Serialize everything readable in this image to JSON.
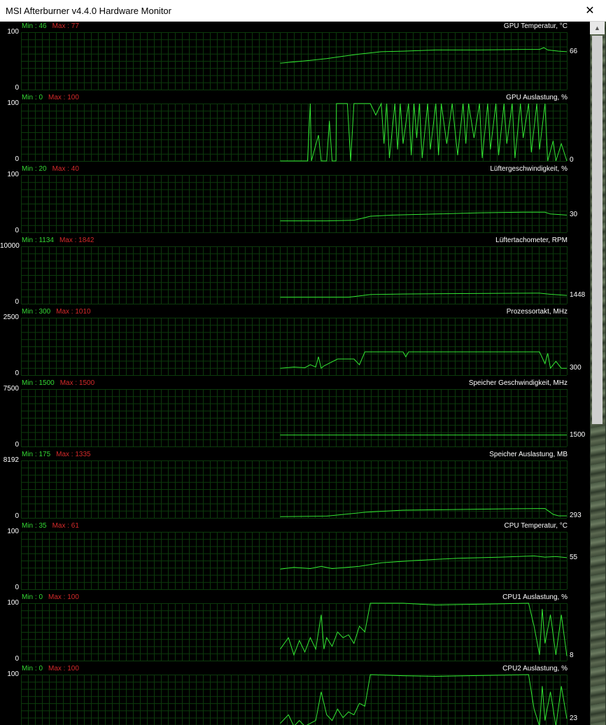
{
  "window": {
    "title": "MSI Afterburner v4.4.0 Hardware Monitor",
    "close_glyph": "✕"
  },
  "graphs": [
    {
      "name": "GPU Temperatur, °C",
      "min_label": "Min : 46",
      "max_label": "Max : 77",
      "axis_max": "100",
      "axis_min": "0",
      "current": "66",
      "max_val": 100,
      "current_val": 66,
      "points": [
        [
          0.475,
          46
        ],
        [
          0.52,
          50
        ],
        [
          0.56,
          54
        ],
        [
          0.59,
          58
        ],
        [
          0.62,
          62
        ],
        [
          0.66,
          66
        ],
        [
          0.7,
          67
        ],
        [
          0.76,
          69
        ],
        [
          0.84,
          69
        ],
        [
          0.92,
          70
        ],
        [
          0.95,
          70
        ],
        [
          0.958,
          73
        ],
        [
          0.965,
          69
        ],
        [
          0.985,
          67
        ],
        [
          1.0,
          66
        ]
      ]
    },
    {
      "name": "GPU Auslastung, %",
      "min_label": "Min : 0",
      "max_label": "Max : 100",
      "axis_max": "100",
      "axis_min": "0",
      "current": "0",
      "max_val": 100,
      "current_val": 0,
      "style": "spiky",
      "points": [
        [
          0.475,
          0
        ],
        [
          0.525,
          0
        ],
        [
          0.53,
          100
        ],
        [
          0.532,
          0
        ],
        [
          0.545,
          45
        ],
        [
          0.55,
          0
        ],
        [
          0.56,
          0
        ],
        [
          0.565,
          70
        ],
        [
          0.57,
          0
        ],
        [
          0.577,
          0
        ],
        [
          0.578,
          100
        ],
        [
          0.59,
          100
        ],
        [
          0.598,
          100
        ],
        [
          0.604,
          0
        ],
        [
          0.61,
          100
        ],
        [
          0.64,
          100
        ],
        [
          0.65,
          80
        ],
        [
          0.66,
          100
        ],
        [
          0.665,
          30
        ],
        [
          0.67,
          100
        ],
        [
          0.675,
          5
        ],
        [
          0.685,
          100
        ],
        [
          0.69,
          20
        ],
        [
          0.695,
          100
        ],
        [
          0.7,
          30
        ],
        [
          0.71,
          100
        ],
        [
          0.715,
          10
        ],
        [
          0.72,
          100
        ],
        [
          0.725,
          40
        ],
        [
          0.73,
          100
        ],
        [
          0.735,
          5
        ],
        [
          0.745,
          100
        ],
        [
          0.75,
          20
        ],
        [
          0.76,
          100
        ],
        [
          0.765,
          10
        ],
        [
          0.77,
          100
        ],
        [
          0.78,
          30
        ],
        [
          0.79,
          100
        ],
        [
          0.8,
          10
        ],
        [
          0.81,
          100
        ],
        [
          0.815,
          30
        ],
        [
          0.82,
          100
        ],
        [
          0.83,
          40
        ],
        [
          0.84,
          100
        ],
        [
          0.845,
          5
        ],
        [
          0.855,
          100
        ],
        [
          0.86,
          20
        ],
        [
          0.87,
          100
        ],
        [
          0.875,
          10
        ],
        [
          0.885,
          100
        ],
        [
          0.89,
          30
        ],
        [
          0.9,
          100
        ],
        [
          0.905,
          5
        ],
        [
          0.915,
          100
        ],
        [
          0.92,
          40
        ],
        [
          0.93,
          100
        ],
        [
          0.935,
          15
        ],
        [
          0.945,
          100
        ],
        [
          0.95,
          20
        ],
        [
          0.96,
          100
        ],
        [
          0.965,
          0
        ],
        [
          0.975,
          35
        ],
        [
          0.98,
          0
        ],
        [
          0.99,
          30
        ],
        [
          1.0,
          0
        ]
      ]
    },
    {
      "name": "Lüftergeschwindigkeit, %",
      "min_label": "Min : 20",
      "max_label": "Max : 40",
      "axis_max": "100",
      "axis_min": "0",
      "current": "30",
      "max_val": 100,
      "current_val": 30,
      "points": [
        [
          0.475,
          20
        ],
        [
          0.56,
          20
        ],
        [
          0.61,
          21
        ],
        [
          0.64,
          28
        ],
        [
          0.68,
          30
        ],
        [
          0.76,
          32
        ],
        [
          0.84,
          34
        ],
        [
          0.92,
          35
        ],
        [
          0.96,
          35
        ],
        [
          0.97,
          32
        ],
        [
          1.0,
          30
        ]
      ]
    },
    {
      "name": "Lüftertachometer, RPM",
      "min_label": "Min : 1134",
      "max_label": "Max : 1842",
      "axis_max": "10000",
      "axis_min": "0",
      "current": "1448",
      "max_val": 10000,
      "current_val": 1448,
      "points": [
        [
          0.475,
          1134
        ],
        [
          0.6,
          1134
        ],
        [
          0.64,
          1600
        ],
        [
          0.7,
          1700
        ],
        [
          0.78,
          1760
        ],
        [
          0.88,
          1820
        ],
        [
          0.95,
          1842
        ],
        [
          0.97,
          1650
        ],
        [
          1.0,
          1448
        ]
      ]
    },
    {
      "name": "Prozessortakt, MHz",
      "min_label": "Min : 300",
      "max_label": "Max : 1010",
      "axis_max": "2500",
      "axis_min": "0",
      "current": "300",
      "max_val": 2500,
      "current_val": 300,
      "points": [
        [
          0.475,
          300
        ],
        [
          0.5,
          350
        ],
        [
          0.52,
          320
        ],
        [
          0.53,
          450
        ],
        [
          0.54,
          350
        ],
        [
          0.545,
          800
        ],
        [
          0.55,
          300
        ],
        [
          0.555,
          400
        ],
        [
          0.58,
          700
        ],
        [
          0.61,
          700
        ],
        [
          0.62,
          450
        ],
        [
          0.63,
          1010
        ],
        [
          0.7,
          1010
        ],
        [
          0.705,
          800
        ],
        [
          0.71,
          1010
        ],
        [
          0.95,
          1010
        ],
        [
          0.96,
          500
        ],
        [
          0.965,
          950
        ],
        [
          0.97,
          300
        ],
        [
          0.98,
          600
        ],
        [
          0.99,
          300
        ],
        [
          1.0,
          300
        ]
      ]
    },
    {
      "name": "Speicher Geschwindigkeit, MHz",
      "min_label": "Min : 1500",
      "max_label": "Max : 1500",
      "axis_max": "7500",
      "axis_min": "0",
      "current": "1500",
      "max_val": 7500,
      "current_val": 1500,
      "points": [
        [
          0.475,
          1500
        ],
        [
          1.0,
          1500
        ]
      ]
    },
    {
      "name": "Speicher Auslastung, MB",
      "min_label": "Min : 175",
      "max_label": "Max : 1335",
      "axis_max": "8192",
      "axis_min": "0",
      "current": "293",
      "max_val": 8192,
      "current_val": 293,
      "points": [
        [
          0.475,
          175
        ],
        [
          0.56,
          250
        ],
        [
          0.63,
          800
        ],
        [
          0.7,
          1100
        ],
        [
          0.8,
          1200
        ],
        [
          0.9,
          1300
        ],
        [
          0.96,
          1335
        ],
        [
          0.975,
          500
        ],
        [
          0.985,
          293
        ],
        [
          1.0,
          293
        ]
      ]
    },
    {
      "name": "CPU Temperatur, °C",
      "min_label": "Min : 35",
      "max_label": "Max : 61",
      "axis_max": "100",
      "axis_min": "0",
      "current": "55",
      "max_val": 100,
      "current_val": 55,
      "points": [
        [
          0.475,
          35
        ],
        [
          0.5,
          38
        ],
        [
          0.53,
          36
        ],
        [
          0.55,
          40
        ],
        [
          0.57,
          36
        ],
        [
          0.62,
          40
        ],
        [
          0.66,
          46
        ],
        [
          0.72,
          50
        ],
        [
          0.8,
          54
        ],
        [
          0.88,
          56
        ],
        [
          0.94,
          58
        ],
        [
          0.96,
          56
        ],
        [
          0.98,
          57
        ],
        [
          1.0,
          55
        ]
      ]
    },
    {
      "name": "CPU1 Auslastung, %",
      "min_label": "Min : 0",
      "max_label": "Max : 100",
      "axis_max": "100",
      "axis_min": "0",
      "current": "8",
      "max_val": 100,
      "current_val": 8,
      "style": "noisy",
      "points": [
        [
          0.475,
          20
        ],
        [
          0.49,
          40
        ],
        [
          0.5,
          10
        ],
        [
          0.51,
          35
        ],
        [
          0.52,
          15
        ],
        [
          0.53,
          40
        ],
        [
          0.54,
          20
        ],
        [
          0.55,
          80
        ],
        [
          0.555,
          20
        ],
        [
          0.56,
          40
        ],
        [
          0.57,
          25
        ],
        [
          0.58,
          50
        ],
        [
          0.59,
          40
        ],
        [
          0.6,
          45
        ],
        [
          0.61,
          30
        ],
        [
          0.62,
          60
        ],
        [
          0.63,
          50
        ],
        [
          0.64,
          100
        ],
        [
          0.7,
          100
        ],
        [
          0.76,
          97
        ],
        [
          0.82,
          98
        ],
        [
          0.88,
          99
        ],
        [
          0.93,
          100
        ],
        [
          0.94,
          60
        ],
        [
          0.95,
          10
        ],
        [
          0.955,
          90
        ],
        [
          0.96,
          30
        ],
        [
          0.97,
          80
        ],
        [
          0.98,
          10
        ],
        [
          0.99,
          80
        ],
        [
          1.0,
          8
        ]
      ]
    },
    {
      "name": "CPU2 Auslastung, %",
      "min_label": "Min : 0",
      "max_label": "Max : 100",
      "axis_max": "100",
      "axis_min": "",
      "current": "23",
      "max_val": 100,
      "current_val": 23,
      "style": "noisy",
      "points": [
        [
          0.475,
          15
        ],
        [
          0.49,
          30
        ],
        [
          0.5,
          10
        ],
        [
          0.51,
          20
        ],
        [
          0.52,
          10
        ],
        [
          0.54,
          20
        ],
        [
          0.55,
          70
        ],
        [
          0.56,
          30
        ],
        [
          0.57,
          20
        ],
        [
          0.58,
          40
        ],
        [
          0.59,
          25
        ],
        [
          0.6,
          35
        ],
        [
          0.61,
          30
        ],
        [
          0.62,
          50
        ],
        [
          0.63,
          45
        ],
        [
          0.64,
          100
        ],
        [
          0.7,
          98
        ],
        [
          0.76,
          97
        ],
        [
          0.82,
          98
        ],
        [
          0.88,
          99
        ],
        [
          0.93,
          100
        ],
        [
          0.94,
          40
        ],
        [
          0.95,
          10
        ],
        [
          0.955,
          80
        ],
        [
          0.96,
          20
        ],
        [
          0.97,
          70
        ],
        [
          0.98,
          10
        ],
        [
          0.99,
          80
        ],
        [
          1.0,
          23
        ]
      ]
    }
  ]
}
